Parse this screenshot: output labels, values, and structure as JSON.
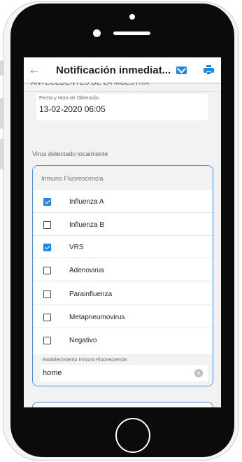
{
  "app": {
    "title": "Notificación inmediat...",
    "section_header": "ANTECEDENTES DE LA MUESTRA"
  },
  "date_field": {
    "label": "Fecha y Hora de Obtención",
    "value": "13-02-2020 06:05"
  },
  "virus_section": {
    "label": "Virus detectado localmente",
    "card_title": "Inmuno Fluorescencia",
    "items": [
      {
        "label": "Influenza A",
        "checked": true
      },
      {
        "label": "Influenza B",
        "checked": false
      },
      {
        "label": "VRS",
        "checked": true
      },
      {
        "label": "Adenovirus",
        "checked": false
      },
      {
        "label": "Parainfluenza",
        "checked": false
      },
      {
        "label": "Metapneumovirus",
        "checked": false
      },
      {
        "label": "Negativo",
        "checked": false
      }
    ],
    "establishment": {
      "label": "Establecimiento Inmuno Fluorescencia",
      "value": "home"
    }
  },
  "icons": {
    "back": "back-arrow-icon",
    "mail": "mail-icon",
    "print": "print-icon",
    "clear": "clear-icon",
    "accent_color": "#1e88e5"
  }
}
